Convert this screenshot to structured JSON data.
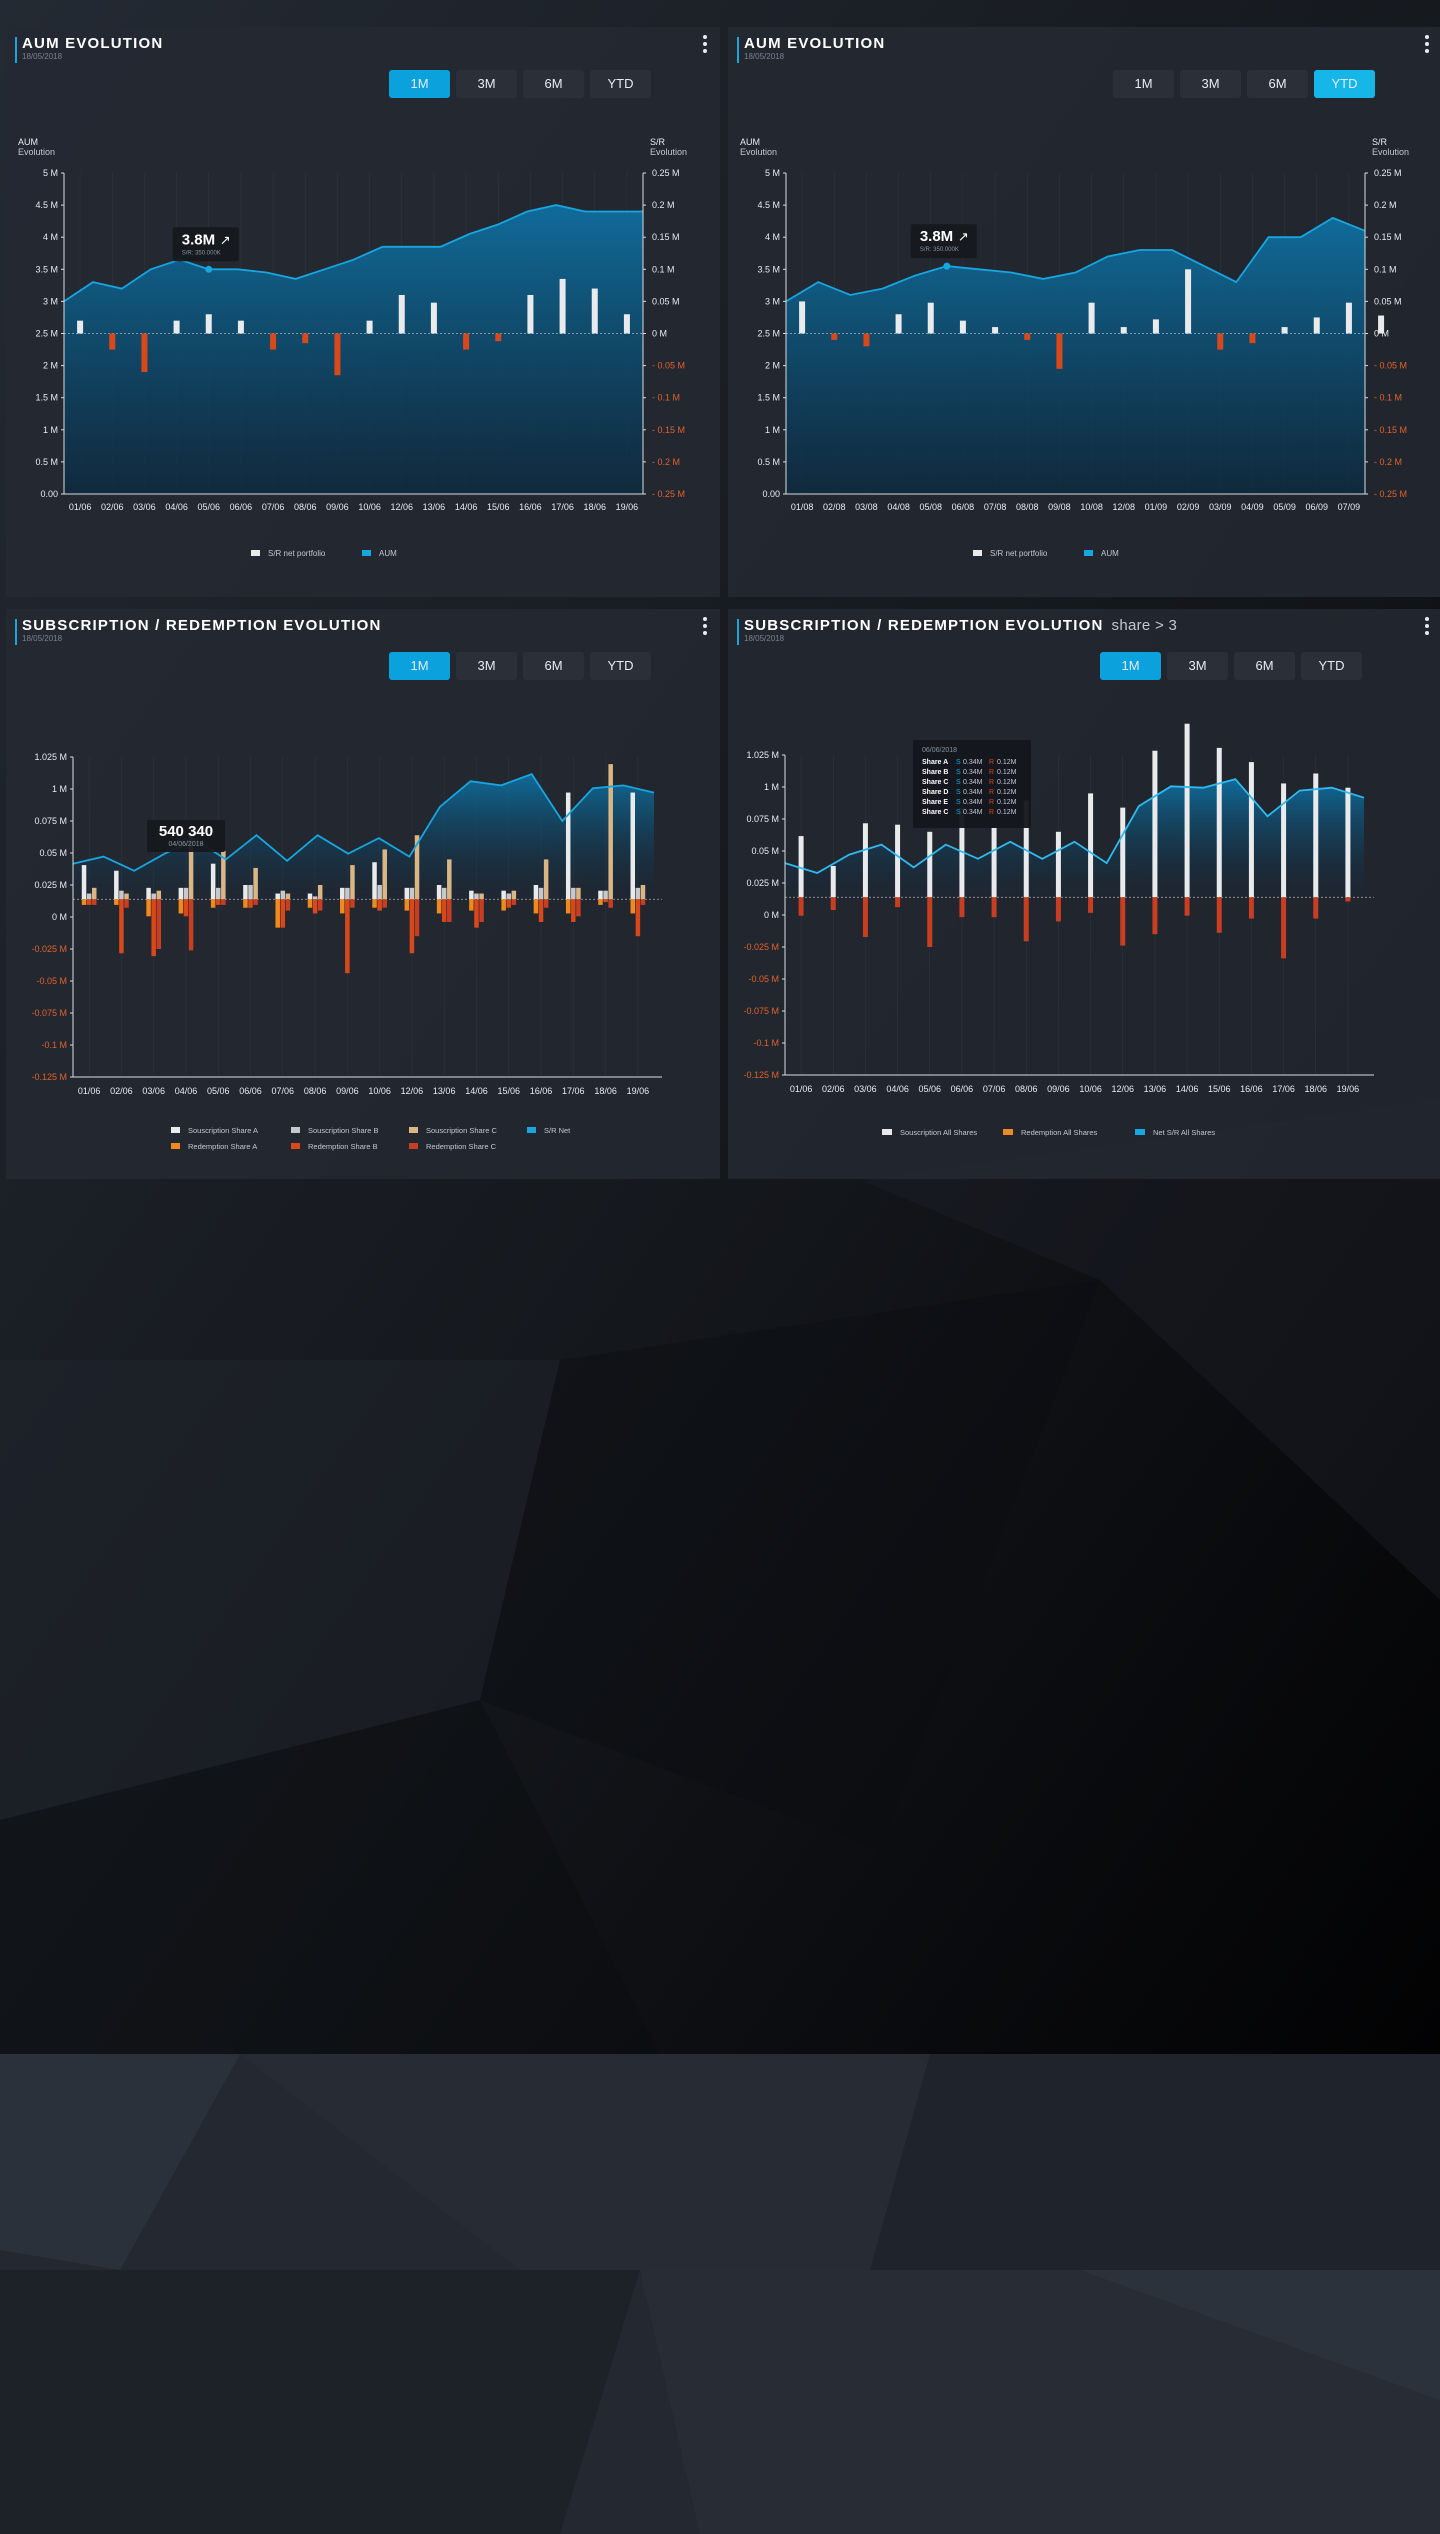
{
  "colors": {
    "aum_line": "#17a6e0",
    "aum_fill": "#0f6fa0",
    "bar_white": "#e9eaec",
    "bar_orange": "#d8481a",
    "tan": "#d9b684",
    "red": "#c73e22",
    "grid": "#3a414d",
    "neg_tick": "#e0622b"
  },
  "panels": [
    {
      "title": "AUM EVOLUTION",
      "subtitle": "",
      "date": "18/05/2018",
      "tabs": [
        "1M",
        "3M",
        "6M",
        "YTD"
      ],
      "active_tab": 0,
      "tooltip": {
        "value": "3.8M",
        "arrow": "↗",
        "line2": "S/R: 350.000K"
      }
    },
    {
      "title": "AUM EVOLUTION",
      "subtitle": "",
      "date": "18/05/2018",
      "tabs": [
        "1M",
        "3M",
        "6M",
        "YTD"
      ],
      "active_tab": 3,
      "tooltip": {
        "value": "3.8M",
        "arrow": "↗",
        "line2": "S/R: 350.000K"
      }
    },
    {
      "title": "SUBSCRIPTION / REDEMPTION EVOLUTION",
      "subtitle": "",
      "date": "18/05/2018",
      "tabs": [
        "1M",
        "3M",
        "6M",
        "YTD"
      ],
      "active_tab": 0,
      "tooltip": {
        "value": "540 340",
        "line2": "04/06/2018"
      }
    },
    {
      "title": "SUBSCRIPTION / REDEMPTION EVOLUTION",
      "subtitle": "share > 3",
      "date": "18/05/2018",
      "tabs": [
        "1M",
        "3M",
        "6M",
        "YTD"
      ],
      "active_tab": 0,
      "tooltip": {
        "date": "06/06/2018",
        "rows": [
          {
            "share": "Share A",
            "s": "S",
            "sv": "0.34M",
            "r": "R",
            "rv": "0.12M"
          },
          {
            "share": "Share B",
            "s": "S",
            "sv": "0.34M",
            "r": "R",
            "rv": "0.12M"
          },
          {
            "share": "Share C",
            "s": "S",
            "sv": "0.34M",
            "r": "R",
            "rv": "0.12M"
          },
          {
            "share": "Share D",
            "s": "S",
            "sv": "0.34M",
            "r": "R",
            "rv": "0.12M"
          },
          {
            "share": "Share E",
            "s": "S",
            "sv": "0.34M",
            "r": "R",
            "rv": "0.12M"
          },
          {
            "share": "Share C",
            "s": "S",
            "sv": "0.34M",
            "r": "R",
            "rv": "0.12M"
          }
        ]
      }
    }
  ],
  "chart_data": [
    {
      "type": "line",
      "title": "AUM EVOLUTION",
      "left_axis_label": [
        "AUM",
        "Evolution"
      ],
      "right_axis_label": [
        "S/R",
        "Evolution"
      ],
      "left_ticks": [
        "5  M",
        "4.5  M",
        "4  M",
        "3.5  M",
        "3  M",
        "2.5  M",
        "2  M",
        "1.5 M",
        "1  M",
        "0.5  M",
        "0.00"
      ],
      "right_ticks": [
        "0.25  M",
        "0.2  M",
        "0.15  M",
        "0.1  M",
        "0.05 M",
        "0 M",
        "- 0.05 M",
        "- 0.1 M",
        "- 0.15 M",
        "- 0.2 M",
        "- 0.25 M"
      ],
      "ylim_left": [
        0,
        5
      ],
      "ylim_right": [
        -0.25,
        0.25
      ],
      "x_labels": [
        "01/06",
        "02/06",
        "03/06",
        "04/06",
        "05/06",
        "06/06",
        "07/06",
        "08/06",
        "09/06",
        "10/06",
        "12/06",
        "13/06",
        "14/06",
        "15/06",
        "16/06",
        "17/06",
        "18/06",
        "19/06"
      ],
      "aum": [
        3.0,
        3.3,
        3.2,
        3.5,
        3.65,
        3.5,
        3.5,
        3.45,
        3.35,
        3.5,
        3.65,
        3.85,
        3.85,
        3.85,
        4.05,
        4.2,
        4.4,
        4.5,
        4.4,
        4.4,
        4.4
      ],
      "sr_net": [
        0.02,
        -0.025,
        -0.06,
        0.02,
        0.03,
        0.02,
        -0.025,
        -0.015,
        -0.065,
        0.02,
        0.06,
        0.048,
        -0.025,
        -0.012,
        0.06,
        0.085,
        0.07,
        0.03
      ],
      "legend": [
        {
          "name": "S/R net portfolio",
          "color": "#e9eaec"
        },
        {
          "name": "AUM",
          "color": "#17a6e0"
        }
      ]
    },
    {
      "type": "line",
      "title": "AUM EVOLUTION",
      "left_axis_label": [
        "AUM",
        "Evolution"
      ],
      "right_axis_label": [
        "S/R",
        "Evolution"
      ],
      "left_ticks": [
        "5  M",
        "4.5  M",
        "4  M",
        "3.5  M",
        "3  M",
        "2.5  M",
        "2  M",
        "1.5 M",
        "1  M",
        "0.5  M",
        "0.00"
      ],
      "right_ticks": [
        "0.25  M",
        "0.2  M",
        "0.15  M",
        "0.1  M",
        "0.05 M",
        "0 M",
        "- 0.05 M",
        "- 0.1 M",
        "- 0.15 M",
        "- 0.2 M",
        "- 0.25 M"
      ],
      "ylim_left": [
        0,
        5
      ],
      "ylim_right": [
        -0.25,
        0.25
      ],
      "x_labels": [
        "01/08",
        "02/08",
        "03/08",
        "04/08",
        "05/08",
        "06/08",
        "07/08",
        "08/08",
        "09/08",
        "10/08",
        "12/08",
        "01/09",
        "02/09",
        "03/09",
        "04/09",
        "05/09",
        "06/09",
        "07/09"
      ],
      "aum": [
        3.0,
        3.3,
        3.1,
        3.2,
        3.4,
        3.55,
        3.5,
        3.45,
        3.35,
        3.45,
        3.7,
        3.8,
        3.8,
        3.55,
        3.3,
        4.0,
        4.0,
        4.3,
        4.1
      ],
      "sr_net": [
        0.05,
        -0.01,
        -0.02,
        0.03,
        0.048,
        0.02,
        0.01,
        -0.01,
        -0.055,
        0.048,
        0.01,
        0.022,
        0.1,
        -0.025,
        -0.015,
        0.01,
        0.025,
        0.048,
        0.028
      ],
      "legend": [
        {
          "name": "S/R net portfolio",
          "color": "#e9eaec"
        },
        {
          "name": "AUM",
          "color": "#17a6e0"
        }
      ]
    },
    {
      "type": "bar",
      "title": "SUBSCRIPTION / REDEMPTION EVOLUTION",
      "y_ticks": [
        "1.025  M",
        "1  M",
        "0.075  M",
        "0.05  M",
        "0.025  M",
        "0  M",
        "-0.025  M",
        "-0.05  M",
        "-0.075  M",
        "-0.1  M",
        "-0.125  M"
      ],
      "ylim": [
        -0.125,
        0.1
      ],
      "x_labels": [
        "01/06",
        "02/06",
        "03/06",
        "04/06",
        "05/06",
        "06/06",
        "07/06",
        "08/06",
        "09/06",
        "10/06",
        "12/06",
        "13/06",
        "14/06",
        "15/06",
        "16/06",
        "17/06",
        "18/06",
        "19/06"
      ],
      "sub_a": [
        0.024,
        0.02,
        0.008,
        0.008,
        0.025,
        0.01,
        0.004,
        0.004,
        0.008,
        0.026,
        0.008,
        0.01,
        0.006,
        0.006,
        0.01,
        0.075,
        0.006,
        0.075
      ],
      "sub_b": [
        0.004,
        0.006,
        0.004,
        0.008,
        0.008,
        0.01,
        0.006,
        0.002,
        0.008,
        0.01,
        0.008,
        0.008,
        0.004,
        0.004,
        0.008,
        0.008,
        0.006,
        0.008
      ],
      "sub_c": [
        0.008,
        0.004,
        0.006,
        0.046,
        0.034,
        0.022,
        0.004,
        0.01,
        0.024,
        0.035,
        0.045,
        0.028,
        0.004,
        0.006,
        0.028,
        0.008,
        0.095,
        0.01
      ],
      "red_a": [
        -0.004,
        -0.004,
        -0.012,
        -0.01,
        -0.006,
        -0.006,
        -0.02,
        -0.006,
        -0.01,
        -0.006,
        -0.008,
        -0.01,
        -0.008,
        -0.008,
        -0.01,
        -0.01,
        -0.004,
        -0.01
      ],
      "red_b": [
        -0.004,
        -0.038,
        -0.04,
        -0.012,
        -0.004,
        -0.006,
        -0.02,
        -0.01,
        -0.052,
        -0.008,
        -0.038,
        -0.016,
        -0.02,
        -0.006,
        -0.016,
        -0.016,
        -0.002,
        -0.026
      ],
      "red_c": [
        -0.004,
        -0.006,
        -0.035,
        -0.036,
        -0.004,
        -0.004,
        -0.008,
        -0.008,
        -0.006,
        -0.006,
        -0.026,
        -0.016,
        -0.016,
        -0.004,
        -0.006,
        -0.012,
        -0.006,
        -0.004
      ],
      "sr_net": [
        0.025,
        0.03,
        0.02,
        0.032,
        0.042,
        0.028,
        0.045,
        0.027,
        0.045,
        0.032,
        0.043,
        0.03,
        0.065,
        0.083,
        0.08,
        0.088,
        0.055,
        0.078,
        0.08,
        0.075
      ],
      "legend": [
        {
          "name": "Souscription Share A",
          "color": "#e9eaec"
        },
        {
          "name": "Souscription Share B",
          "color": "#c6c8cc"
        },
        {
          "name": "Souscription Share C",
          "color": "#d9b684"
        },
        {
          "name": "S/R Net",
          "color": "#17a6e0"
        },
        {
          "name": "Redemption Share A",
          "color": "#f08a1c"
        },
        {
          "name": "Redemption Share B",
          "color": "#d8481a"
        },
        {
          "name": "Redemption Share C",
          "color": "#c73e22"
        }
      ]
    },
    {
      "type": "bar",
      "title": "SUBSCRIPTION / REDEMPTION EVOLUTION",
      "y_ticks": [
        "1.025  M",
        "1  M",
        "0.075  M",
        "0.05  M",
        "0.025  M",
        "0  M",
        "-0.025  M",
        "-0.05  M",
        "-0.075  M",
        "-0.1  M",
        "-0.125  M"
      ],
      "ylim": [
        -0.125,
        0.1
      ],
      "x_labels": [
        "01/06",
        "02/06",
        "03/06",
        "04/06",
        "05/06",
        "06/06",
        "07/06",
        "08/06",
        "09/06",
        "10/06",
        "12/06",
        "13/06",
        "14/06",
        "15/06",
        "16/06",
        "17/06",
        "18/06",
        "19/06"
      ],
      "subscriptions": [
        0.043,
        0.022,
        0.052,
        0.051,
        0.046,
        0.063,
        0.049,
        0.068,
        0.046,
        0.073,
        0.063,
        0.103,
        0.122,
        0.105,
        0.095,
        0.08,
        0.087,
        0.077
      ],
      "redemptions": [
        -0.013,
        -0.009,
        -0.028,
        -0.007,
        -0.035,
        -0.014,
        -0.014,
        -0.031,
        -0.017,
        -0.011,
        -0.034,
        -0.026,
        -0.013,
        -0.025,
        -0.015,
        -0.043,
        -0.015,
        -0.003
      ],
      "sr_net": [
        0.024,
        0.017,
        0.03,
        0.037,
        0.021,
        0.037,
        0.027,
        0.039,
        0.027,
        0.039,
        0.024,
        0.064,
        0.078,
        0.077,
        0.083,
        0.057,
        0.075,
        0.077,
        0.07
      ],
      "legend": [
        {
          "name": "Souscription All Shares",
          "color": "#e9eaec"
        },
        {
          "name": "Redemption All Shares",
          "color": "#f08a1c"
        },
        {
          "name": "Net S/R All Shares",
          "color": "#17a6e0"
        }
      ]
    }
  ]
}
